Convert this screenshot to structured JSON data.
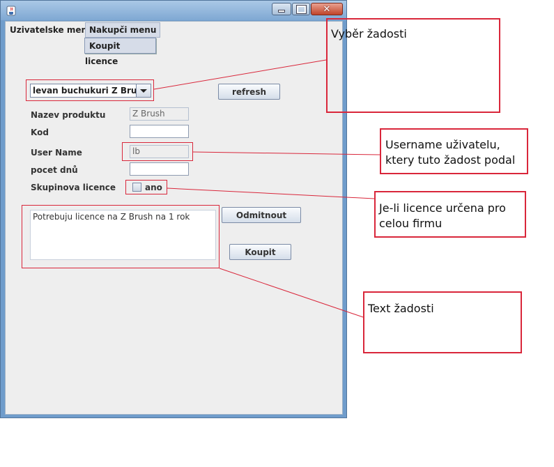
{
  "window": {
    "icon": "java-cup-icon"
  },
  "menubar": {
    "items": [
      {
        "label": "Uzivatelske menu"
      },
      {
        "label": "Nakupči menu"
      }
    ],
    "submenu": {
      "label": "Koupit licence"
    }
  },
  "form": {
    "combo_value": "levan buchukuri Z Brush",
    "refresh_label": "refresh",
    "nazev_label": "Nazev produktu",
    "nazev_value": "Z Brush",
    "kod_label": "Kod",
    "kod_value": "",
    "username_label": "User Name",
    "username_value": "lb",
    "pocet_label": "pocet dnů",
    "pocet_value": "",
    "skupinova_label": "Skupinova licence",
    "ano_label": "ano",
    "ano_checked": false,
    "text": "Potrebuju licence na Z Brush na 1 rok",
    "odmitnout_label": "Odmitnout",
    "koupit_label": "Koupit"
  },
  "annotations": {
    "vyber": "Vyběr žadosti",
    "username": "Username uživatelu, ktery tuto žadost podal",
    "licence": "Je-li licence určena pro celou firmu",
    "text": "Text žadosti"
  },
  "colors": {
    "annotation_red": "#d9263a",
    "titlebar": "#7fa8d3",
    "client_bg": "#eeeeee"
  }
}
